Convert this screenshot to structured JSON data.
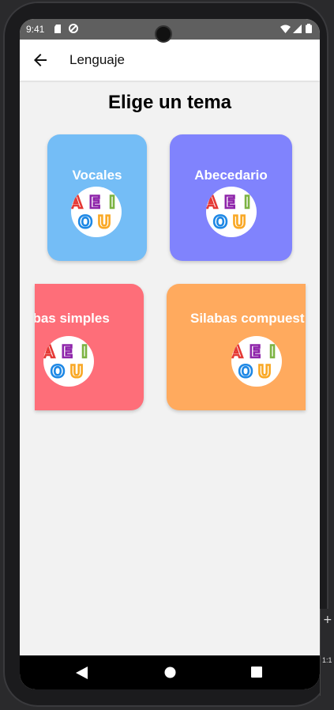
{
  "status_bar": {
    "time": "9:41"
  },
  "app_bar": {
    "title": "Lenguaje"
  },
  "heading": "Elige un tema",
  "topics": [
    {
      "label": "Vocales",
      "color": "#74bdf6"
    },
    {
      "label": "Abecedario",
      "color": "#8083fd"
    },
    {
      "label": "Sílabas simples",
      "visible_label": "abas simples",
      "color": "#fe6e79"
    },
    {
      "label": "Sílabas compuestas",
      "visible_label": "Silabas compuest",
      "color": "#ffaa5e"
    }
  ],
  "vowels_badge": {
    "letters": [
      "A",
      "E",
      "I",
      "O",
      "U"
    ],
    "colors": [
      "#e53935",
      "#8e24aa",
      "#7cb342",
      "#1e88e5",
      "#f9a825"
    ]
  },
  "side_panel": {
    "zoom_text": "1:1"
  }
}
